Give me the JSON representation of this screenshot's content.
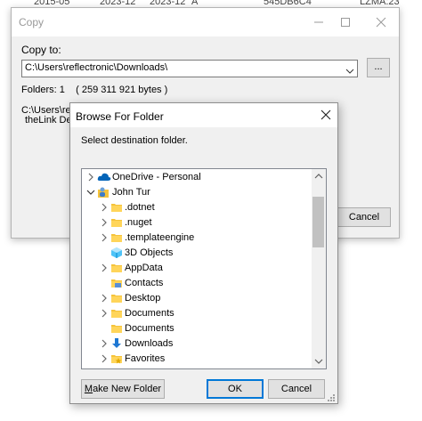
{
  "background_row": [
    "2015-05",
    "2023-12",
    "2023-12",
    "A",
    "545DB6C4",
    "LZMA:23"
  ],
  "copy_dialog": {
    "title": "Copy",
    "copy_to_label": "Copy to:",
    "path_value": "C:\\Users\\reflectronic\\Downloads\\",
    "browse_label": "...",
    "folders_info": "Folders: 1    ( 259 311 921 bytes )",
    "path_line": "C:\\Users\\refle",
    "path_line2": "theLink Des",
    "cancel_label": "Cancel"
  },
  "browse_dialog": {
    "title": "Browse For Folder",
    "instruction": "Select destination folder.",
    "tree": [
      {
        "label": "OneDrive - Personal",
        "icon": "onedrive-cloud-icon",
        "expander": "collapsed",
        "level": 0
      },
      {
        "label": "John Tur",
        "icon": "user-folder-icon",
        "expander": "expanded",
        "level": 0
      },
      {
        "label": ".dotnet",
        "icon": "folder-icon",
        "expander": "collapsed",
        "level": 1
      },
      {
        "label": ".nuget",
        "icon": "folder-icon",
        "expander": "collapsed",
        "level": 1
      },
      {
        "label": ".templateengine",
        "icon": "folder-icon",
        "expander": "collapsed",
        "level": 1
      },
      {
        "label": "3D Objects",
        "icon": "3d-objects-icon",
        "expander": "none",
        "level": 1
      },
      {
        "label": "AppData",
        "icon": "folder-icon",
        "expander": "collapsed",
        "level": 1
      },
      {
        "label": "Contacts",
        "icon": "contacts-folder-icon",
        "expander": "none",
        "level": 1
      },
      {
        "label": "Desktop",
        "icon": "folder-icon",
        "expander": "collapsed",
        "level": 1
      },
      {
        "label": "Documents",
        "icon": "folder-icon",
        "expander": "collapsed",
        "level": 1
      },
      {
        "label": "Documents",
        "icon": "folder-icon",
        "expander": "none",
        "level": 1
      },
      {
        "label": "Downloads",
        "icon": "downloads-icon",
        "expander": "collapsed",
        "level": 1
      },
      {
        "label": "Favorites",
        "icon": "favorites-folder-icon",
        "expander": "collapsed",
        "level": 1
      }
    ],
    "new_folder_label": "Make New Folder",
    "new_folder_mnemonic": "M",
    "new_folder_rest": "ake New Folder",
    "ok_label": "OK",
    "cancel_label": "Cancel"
  },
  "colors": {
    "folder": "#f5c33b",
    "onedrive": "#0364b8",
    "downloads_arrow": "#1e77d3",
    "ok_border": "#0078d7"
  }
}
